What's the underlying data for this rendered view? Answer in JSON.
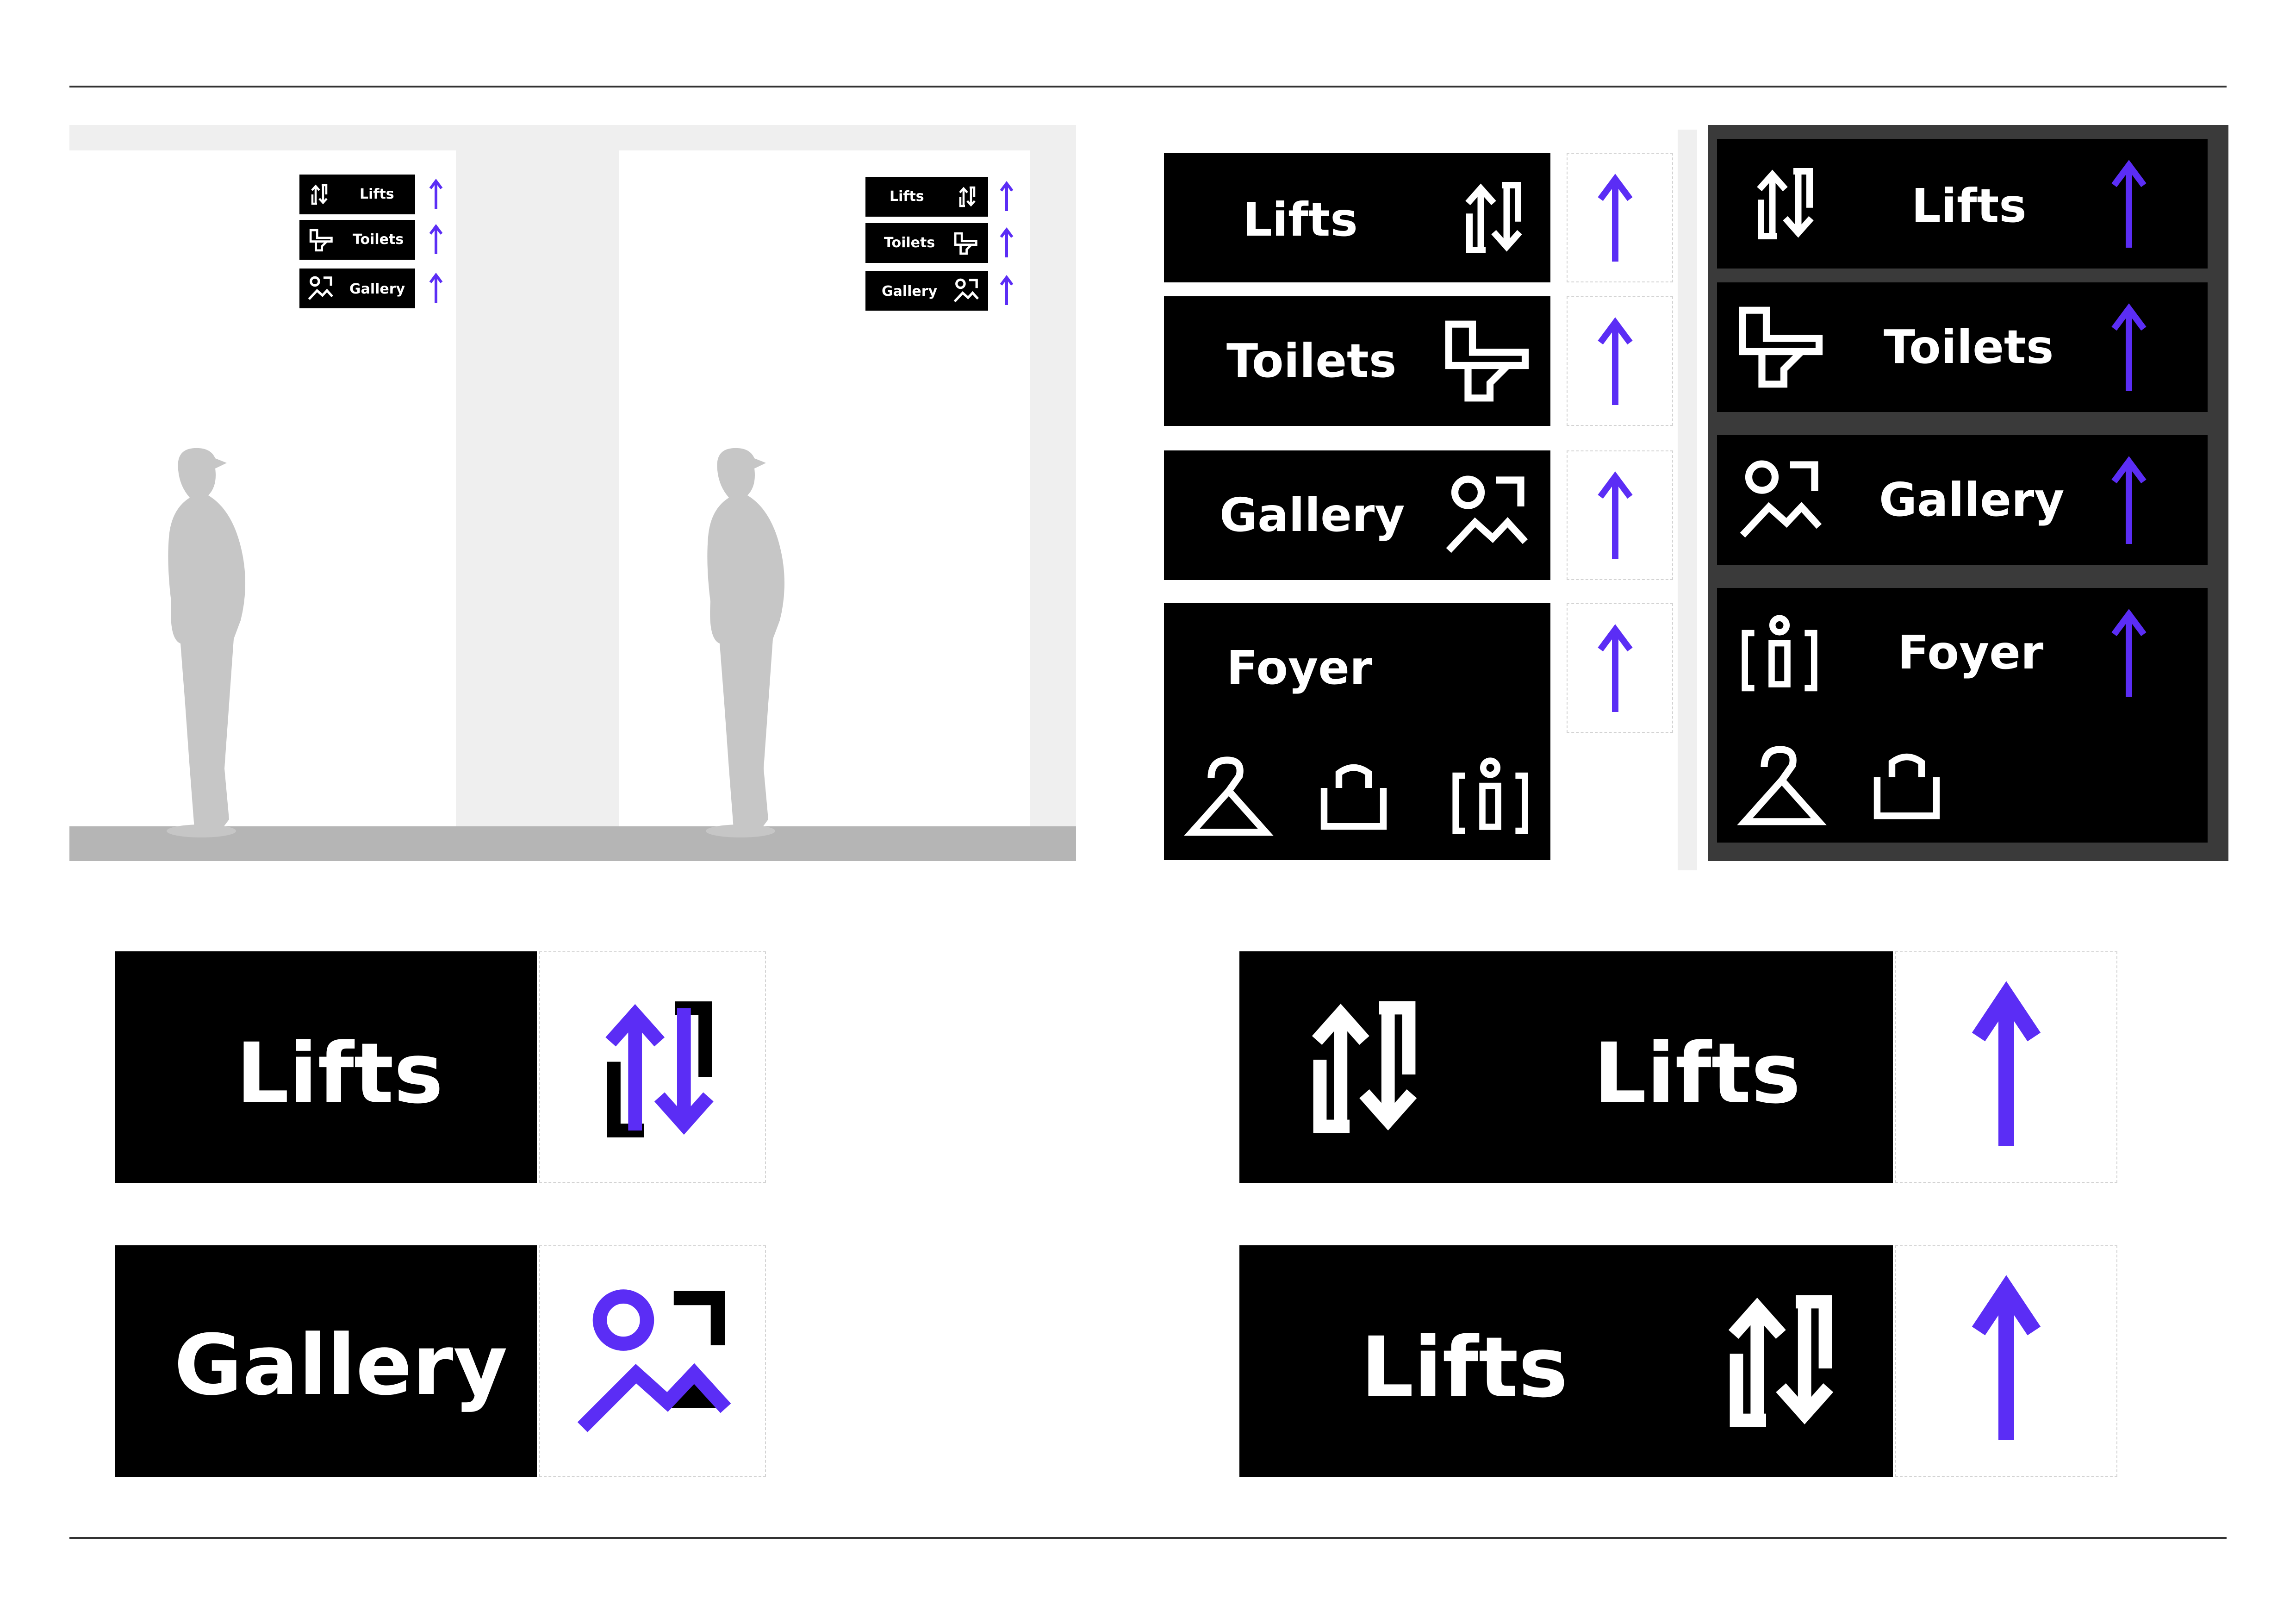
{
  "colors": {
    "accent": "#5b2df5",
    "sign_bg": "#000000",
    "sign_text": "#ffffff",
    "dark_panel": "#3a3a3a",
    "wall_grey": "#efefef",
    "floor_grey": "#b5b5b5",
    "silhouette": "#c6c6c6"
  },
  "mockup": {
    "left_wall_signs": [
      "Lifts",
      "Toilets",
      "Gallery"
    ],
    "right_wall_signs": [
      "Lifts",
      "Toilets",
      "Gallery"
    ]
  },
  "light_set": {
    "signs": [
      "Lifts",
      "Toilets",
      "Gallery",
      "Foyer"
    ]
  },
  "dark_set": {
    "signs": [
      "Lifts",
      "Toilets",
      "Gallery",
      "Foyer"
    ]
  },
  "large_examples": {
    "left": [
      "Lifts",
      "Gallery"
    ],
    "right": [
      "Lifts",
      "Lifts"
    ]
  },
  "icons": [
    "lifts-icon",
    "toilet-icon",
    "gallery-icon",
    "info-icon",
    "cloakroom-hanger-icon",
    "shop-bag-icon",
    "up-arrow-icon"
  ]
}
